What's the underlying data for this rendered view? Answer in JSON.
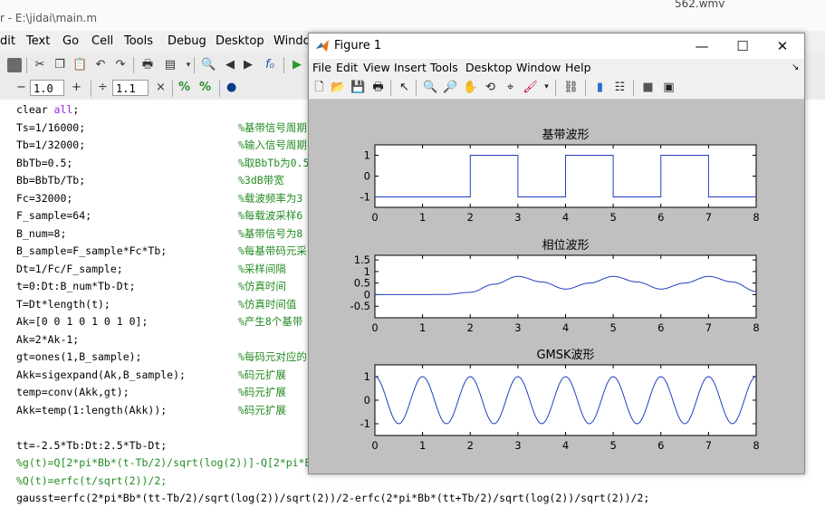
{
  "taskbar": {
    "file_label": "562.wmv"
  },
  "editor": {
    "title": "r - E:\\jidai\\main.m",
    "menu": [
      "dit",
      "Text",
      "Go",
      "Cell",
      "Tools",
      "Debug",
      "Desktop",
      "Windo"
    ],
    "cell_toolbar": {
      "minus": "−",
      "value1": "1.0",
      "plus": "+",
      "divide": "÷",
      "value2": "1.1",
      "times": "×"
    },
    "code_lines": [
      {
        "code": "clear all;",
        "comment": ""
      },
      {
        "code": "Ts=1/16000;",
        "comment": "%基带信号周期"
      },
      {
        "code": "Tb=1/32000;",
        "comment": "%输入信号周期"
      },
      {
        "code": "BbTb=0.5;",
        "comment": "%取BbTb为0.5"
      },
      {
        "code": "Bb=BbTb/Tb;",
        "comment": "%3dB带宽"
      },
      {
        "code": "Fc=32000;",
        "comment": "%载波频率为3"
      },
      {
        "code": "F_sample=64;",
        "comment": "%每载波采样6"
      },
      {
        "code": "B_num=8;",
        "comment": "%基带信号为8"
      },
      {
        "code": "B_sample=F_sample*Fc*Tb;",
        "comment": "%每基带码元采"
      },
      {
        "code": "Dt=1/Fc/F_sample;",
        "comment": "%采样间隔"
      },
      {
        "code": "t=0:Dt:B_num*Tb-Dt;",
        "comment": "%仿真时间"
      },
      {
        "code": "T=Dt*length(t);",
        "comment": "%仿真时间值"
      },
      {
        "code": "Ak=[0 0 1 0 1 0 1 0];",
        "comment": "%产生8个基带"
      },
      {
        "code": "Ak=2*Ak-1;",
        "comment": ""
      },
      {
        "code": "gt=ones(1,B_sample);",
        "comment": "%每码元对应的"
      },
      {
        "code": "Akk=sigexpand(Ak,B_sample);",
        "comment": "%码元扩展"
      },
      {
        "code": "temp=conv(Akk,gt);",
        "comment": "%码元扩展"
      },
      {
        "code": "Akk=temp(1:length(Akk));",
        "comment": "%码元扩展"
      },
      {
        "code": "",
        "comment": ""
      },
      {
        "code": "tt=-2.5*Tb:Dt:2.5*Tb-Dt;",
        "comment": ""
      },
      {
        "code": "%g(t)=Q[2*pi*Bb*(t-Tb/2)/sqrt(log(2))]-Q[2*pi*Bb",
        "comment": ""
      },
      {
        "code": "%Q(t)=erfc(t/sqrt(2))/2;",
        "comment": ""
      },
      {
        "code": "gausst=erfc(2*pi*Bb*(tt-Tb/2)/sqrt(log(2))/sqrt(2))/2-erfc(2*pi*Bb*(tt+Tb/2)/sqrt(log(2))/sqrt(2))/2;",
        "comment": ""
      }
    ]
  },
  "figure": {
    "title": "Figure 1",
    "menu": [
      "File",
      "Edit",
      "View",
      "Insert",
      "Tools",
      "Desktop",
      "Window",
      "Help"
    ],
    "window_buttons": {
      "minimize": "—",
      "maximize": "☐",
      "close": "✕"
    }
  },
  "chart_data": [
    {
      "type": "line",
      "title": "基带波形",
      "xlim": [
        0,
        8
      ],
      "ylim": [
        -1.5,
        1.5
      ],
      "xticks": [
        "0",
        "1",
        "2",
        "3",
        "4",
        "5",
        "6",
        "7",
        "8"
      ],
      "yticks": [
        "1",
        "0",
        "-1"
      ],
      "ytick_values": [
        1,
        0,
        -1
      ],
      "series": [
        {
          "x": [
            0,
            2,
            2,
            3,
            3,
            4,
            4,
            5,
            5,
            6,
            6,
            7,
            7,
            8
          ],
          "y": [
            -1,
            -1,
            1,
            1,
            -1,
            -1,
            1,
            1,
            -1,
            -1,
            1,
            1,
            -1,
            -1
          ]
        }
      ]
    },
    {
      "type": "line",
      "title": "相位波形",
      "xlim": [
        0,
        8
      ],
      "ylim": [
        -1,
        1.7
      ],
      "xticks": [
        "0",
        "1",
        "2",
        "3",
        "4",
        "5",
        "6",
        "7",
        "8"
      ],
      "yticks": [
        "1.5",
        "1",
        "0.5",
        "0",
        "-0.5"
      ],
      "ytick_values": [
        1.5,
        1,
        0.5,
        0,
        -0.5
      ],
      "series": [
        {
          "x": [
            0,
            1,
            1.5,
            2,
            2.5,
            3,
            3.5,
            4,
            4.5,
            5,
            5.5,
            6,
            6.5,
            7,
            7.5,
            8
          ],
          "y": [
            0,
            0,
            0.01,
            0.1,
            0.45,
            0.79,
            0.55,
            0.24,
            0.5,
            0.79,
            0.55,
            0.24,
            0.5,
            0.79,
            0.55,
            0.14
          ]
        }
      ]
    },
    {
      "type": "line",
      "title": "GMSK波形",
      "xlim": [
        0,
        8
      ],
      "ylim": [
        -1.5,
        1.5
      ],
      "xticks": [
        "0",
        "1",
        "2",
        "3",
        "4",
        "5",
        "6",
        "7",
        "8"
      ],
      "yticks": [
        "1",
        "0",
        "-1"
      ],
      "ytick_values": [
        1,
        0,
        -1
      ],
      "series": [
        {
          "name": "",
          "function": "cos(2*pi*1*x) modulated",
          "x_range": [
            0,
            8
          ]
        }
      ]
    }
  ]
}
